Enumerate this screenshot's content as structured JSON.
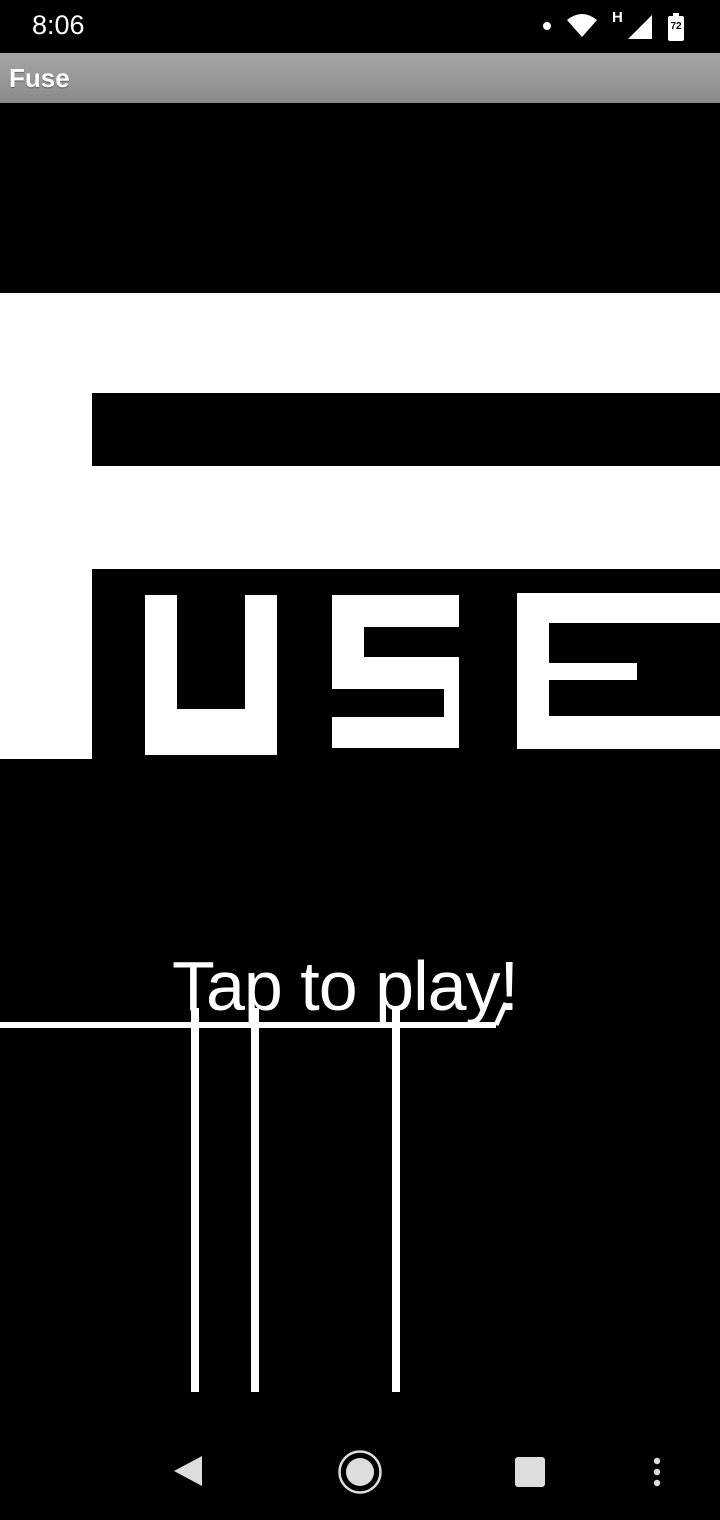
{
  "status_bar": {
    "time": "8:06",
    "battery_level": "72",
    "network_type": "H"
  },
  "app": {
    "title": "Fuse"
  },
  "game": {
    "prompt": "Tap to play!",
    "colors": {
      "background": "#000000",
      "foreground": "#ffffff"
    }
  },
  "nav_bar": {
    "back_icon": "back-triangle-icon",
    "home_icon": "home-circle-icon",
    "recents_icon": "recents-square-icon",
    "menu_icon": "overflow-menu-icon"
  }
}
